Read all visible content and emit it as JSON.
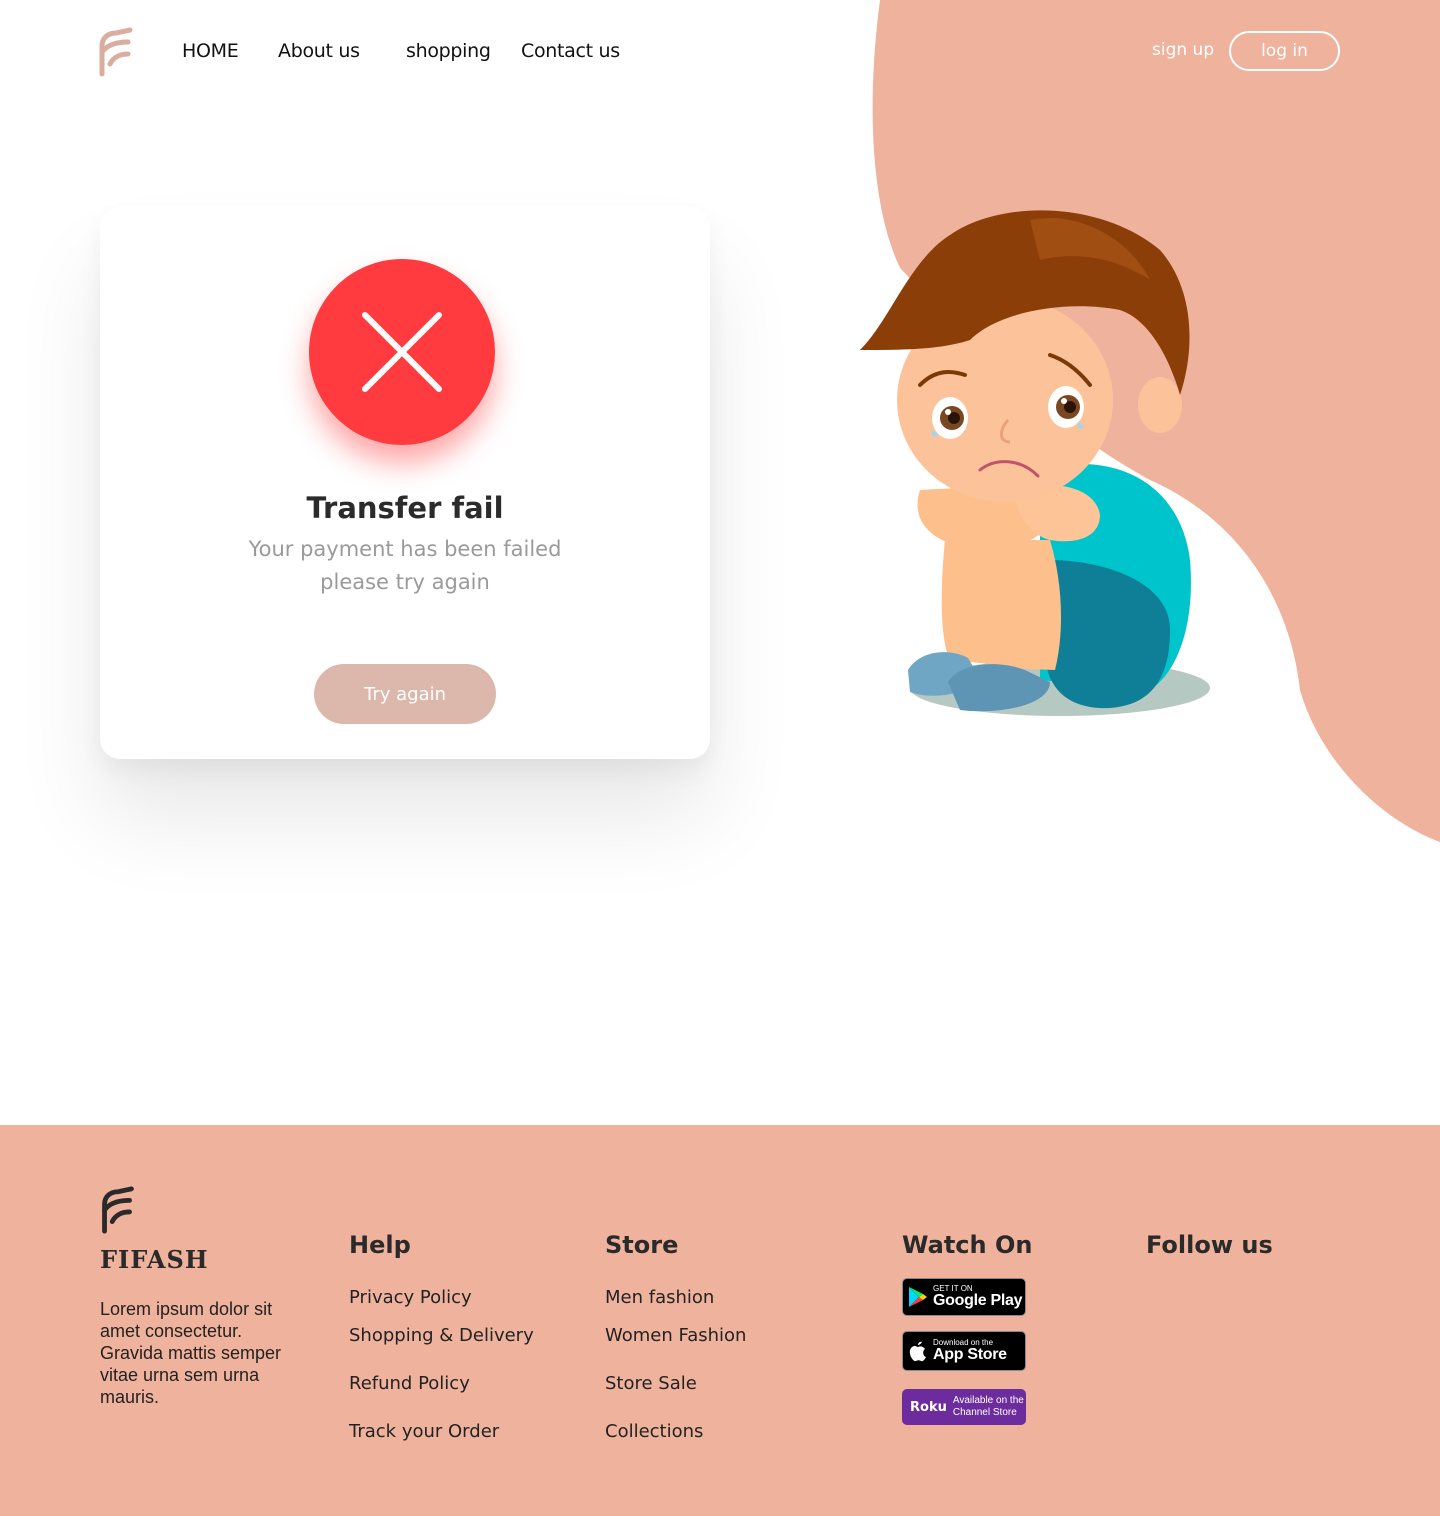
{
  "colors": {
    "accent": "#efb39d",
    "error": "#ff3b3f",
    "button": "#dbb8ab"
  },
  "nav": {
    "items": [
      {
        "label": "HOME"
      },
      {
        "label": "About us"
      },
      {
        "label": "shopping"
      },
      {
        "label": "Contact us"
      }
    ],
    "signup": "sign up",
    "login": "log in"
  },
  "card": {
    "icon": "close-x-icon",
    "title": "Transfer fail",
    "message_line1": "Your payment has been failed",
    "message_line2": "please try again",
    "button": "Try again"
  },
  "footer": {
    "brand": "FIFASH",
    "about": "Lorem ipsum dolor sit amet consectetur. Gravida mattis semper vitae urna sem urna mauris.",
    "help": {
      "title": "Help",
      "links": [
        "Privacy Policy",
        "Shopping & Delivery",
        "Refund Policy",
        "Track your Order"
      ]
    },
    "store": {
      "title": "Store",
      "links": [
        "Men fashion",
        "Women Fashion",
        "Store Sale",
        "Collections"
      ]
    },
    "watch": {
      "title": "Watch On",
      "google_small": "GET IT ON",
      "google_big": "Google Play",
      "apple_small": "Download on the",
      "apple_big": "App Store",
      "roku_brand": "Roku",
      "roku_line1": "Available on the",
      "roku_line2": "Channel Store"
    },
    "follow": {
      "title": "Follow us"
    }
  }
}
